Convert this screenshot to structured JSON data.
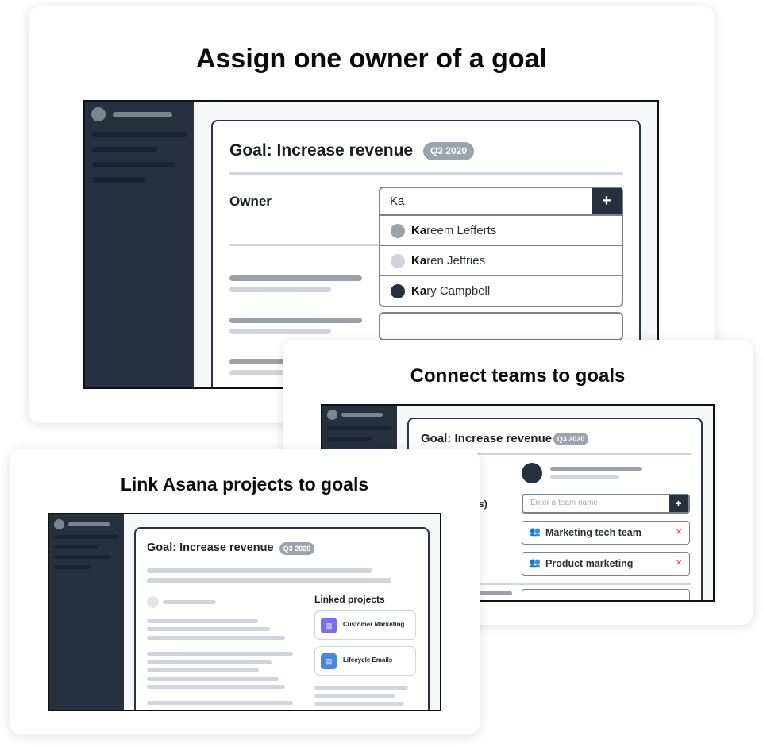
{
  "cards": [
    {
      "title": "Assign one owner of a goal",
      "goal_title": "Goal: Increase revenue",
      "badge": "Q3 2020",
      "owner_label": "Owner",
      "search_value": "Ka",
      "add_icon": "plus-icon",
      "suggestions": [
        {
          "match": "Ka",
          "rest": "reem Lefferts",
          "color": "#9ca3ab"
        },
        {
          "match": "Ka",
          "rest": "ren Jeffries",
          "color": "#d0d6dc"
        },
        {
          "match": "Ka",
          "rest": "ry Campbell",
          "color": "#263140"
        }
      ]
    },
    {
      "title": "Connect teams to goals",
      "goal_title": "Goal: Increase revenue",
      "badge": "Q3 2020",
      "team_label": "eam(s)",
      "team_placeholder": "Enter a team name",
      "teams": [
        {
          "name": "Marketing tech team",
          "icon": "team-icon",
          "remove_icon": "close-icon"
        },
        {
          "name": "Product marketing",
          "icon": "team-icon",
          "remove_icon": "close-icon"
        }
      ],
      "remove_color": "#e8384f"
    },
    {
      "title": "Link Asana projects to goals",
      "goal_title": "Goal: Increase revenue",
      "badge": "Q3 2020",
      "linked_label": "Linked projects",
      "projects": [
        {
          "name": "Customer Marketing",
          "color": "#7b6cf0",
          "icon": "project-icon"
        },
        {
          "name": "Lifecycle Emails",
          "color": "#4a86e0",
          "icon": "project-icon"
        }
      ]
    }
  ]
}
